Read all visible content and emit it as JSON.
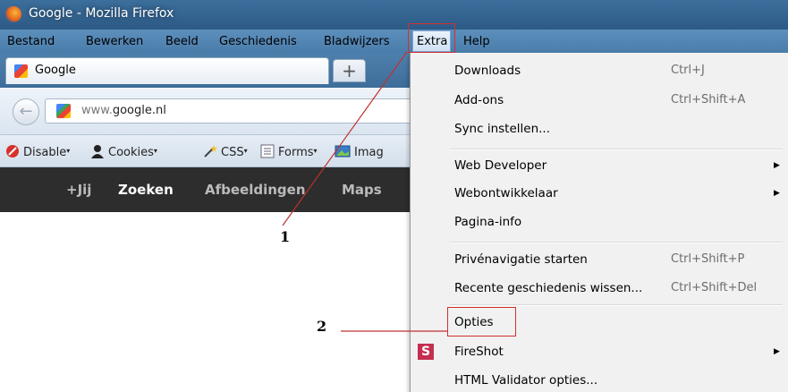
{
  "window": {
    "title": "Google - Mozilla Firefox"
  },
  "menubar": {
    "items": [
      {
        "label": "Bestand"
      },
      {
        "label": "Bewerken"
      },
      {
        "label": "Beeld"
      },
      {
        "label": "Geschiedenis"
      },
      {
        "label": "Bladwijzers"
      },
      {
        "label": "Extra"
      },
      {
        "label": "Help"
      }
    ]
  },
  "tab": {
    "label": "Google",
    "new_tab_label": "+"
  },
  "navbar": {
    "url_prefix": "www.",
    "url_domain": "google.nl"
  },
  "webdev_toolbar": {
    "items": [
      {
        "label": "Disable"
      },
      {
        "label": "Cookies"
      },
      {
        "label": "CSS"
      },
      {
        "label": "Forms"
      },
      {
        "label": "Imag"
      }
    ]
  },
  "google_bar": {
    "items": [
      {
        "label": "+Jij"
      },
      {
        "label": "Zoeken"
      },
      {
        "label": "Afbeeldingen"
      },
      {
        "label": "Maps"
      }
    ]
  },
  "extra_menu": {
    "items": [
      {
        "label": "Downloads",
        "shortcut": "Ctrl+J"
      },
      {
        "label": "Add-ons",
        "shortcut": "Ctrl+Shift+A"
      },
      {
        "label": "Sync instellen..."
      },
      {
        "label": "Web Developer",
        "submenu": true
      },
      {
        "label": "Webontwikkelaar",
        "submenu": true
      },
      {
        "label": "Pagina-info"
      },
      {
        "label": "Privénavigatie starten",
        "shortcut": "Ctrl+Shift+P"
      },
      {
        "label": "Recente geschiedenis wissen...",
        "shortcut": "Ctrl+Shift+Del"
      },
      {
        "label": "Opties"
      },
      {
        "label": "FireShot",
        "submenu": true
      },
      {
        "label": "HTML Validator opties..."
      }
    ]
  },
  "annotations": {
    "callout_1": "1",
    "callout_2": "2"
  },
  "colors": {
    "highlight_box": "#d03030",
    "titlebar": "#3d6f9c",
    "google_bar": "#2d2d2d"
  }
}
